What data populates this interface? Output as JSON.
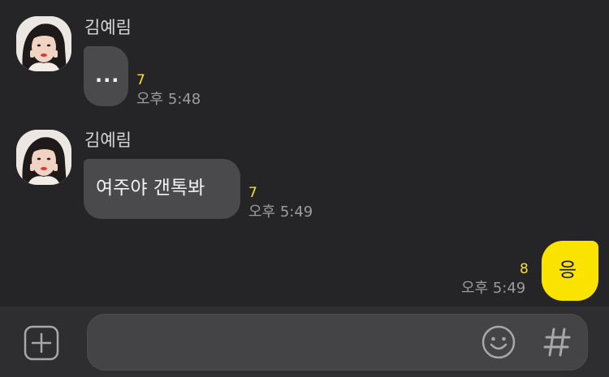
{
  "messages": [
    {
      "sender": "김예림",
      "text": "...",
      "unread": "7",
      "time": "오후 5:48"
    },
    {
      "sender": "김예림",
      "text": "여주야 갠톡봐",
      "unread": "7",
      "time": "오후 5:49"
    },
    {
      "sender": "me",
      "text": "응",
      "unread": "8",
      "time": "오후 5:49"
    }
  ],
  "input": {
    "value": "",
    "placeholder": ""
  },
  "icons": {
    "attach": "plus-box-icon",
    "emoji": "emoji-icon",
    "hashtag": "hashtag-icon"
  },
  "colors": {
    "background": "#252528",
    "incoming_bubble": "#4a4a4c",
    "outgoing_bubble": "#fbe300",
    "unread_count": "#f7e034"
  }
}
